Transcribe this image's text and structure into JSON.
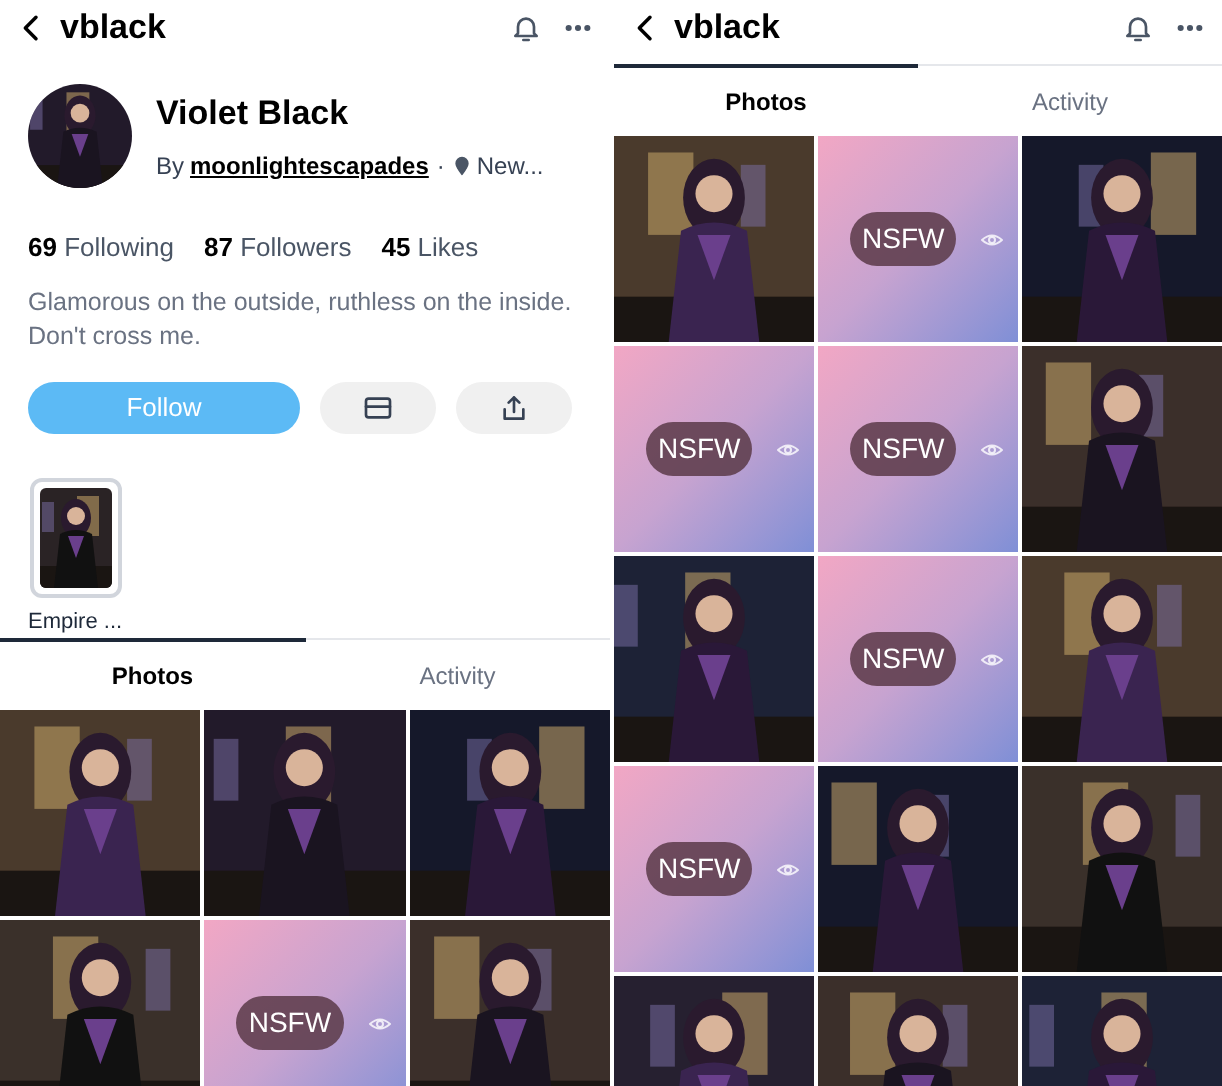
{
  "left_panel": {
    "header": {
      "title": "vblack"
    },
    "profile": {
      "avatar": {
        "kind": "picture"
      },
      "name": "Violet Black",
      "by": "By",
      "creator": "moonlightescapades",
      "separator": "·",
      "location": "New..."
    },
    "stats": [
      "**69** Following",
      "**87** Followers",
      "**45** Likes"
    ],
    "bio": "Glamorous on the outside, ruthless on the inside. Don't cross me.",
    "follow_button": "Follow",
    "collections": [
      {
        "label": "Empire ..."
      }
    ],
    "tabs": [
      {
        "label": "Photos",
        "selected": true
      },
      {
        "label": "Activity",
        "selected": false
      }
    ],
    "grid": [
      {
        "kind": "picture"
      },
      {
        "kind": "picture"
      },
      {
        "kind": "picture"
      },
      {
        "kind": "picture"
      },
      {
        "kind": "nsfw",
        "label": "NSFW"
      },
      {
        "kind": "picture"
      }
    ]
  },
  "right_panel": {
    "header": {
      "title": "vblack"
    },
    "tabs": [
      {
        "label": "Photos",
        "selected": true
      },
      {
        "label": "Activity",
        "selected": false
      }
    ],
    "grid": [
      {
        "kind": "picture"
      },
      {
        "kind": "nsfw",
        "label": "NSFW"
      },
      {
        "kind": "picture"
      },
      {
        "kind": "nsfw",
        "label": "NSFW"
      },
      {
        "kind": "nsfw",
        "label": "NSFW"
      },
      {
        "kind": "picture"
      },
      {
        "kind": "picture"
      },
      {
        "kind": "nsfw",
        "label": "NSFW"
      },
      {
        "kind": "picture"
      },
      {
        "kind": "nsfw",
        "label": "NSFW"
      },
      {
        "kind": "picture"
      },
      {
        "kind": "picture"
      },
      {
        "kind": "picture"
      },
      {
        "kind": "picture"
      },
      {
        "kind": "picture"
      }
    ]
  }
}
